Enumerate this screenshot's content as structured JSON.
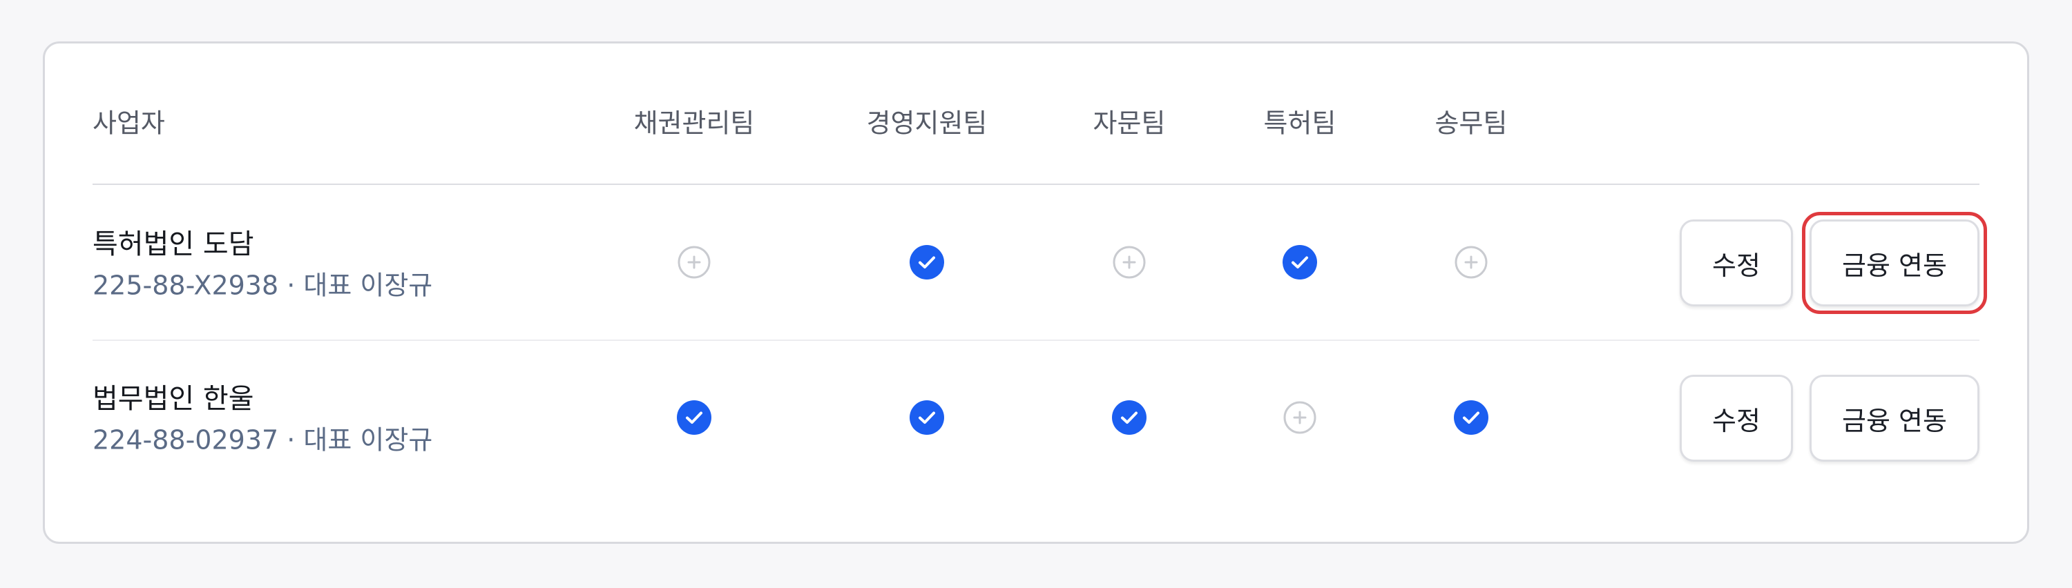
{
  "table": {
    "headers": {
      "business": "사업자",
      "teams": [
        "채권관리팀",
        "경영지원팀",
        "자문팀",
        "특허팀",
        "송무팀"
      ]
    },
    "rows": [
      {
        "name": "특허법인 도담",
        "sub": "225-88-X2938 · 대표 이장규",
        "teams": [
          false,
          true,
          false,
          true,
          false
        ],
        "edit_label": "수정",
        "link_label": "금융 연동",
        "link_highlighted": true
      },
      {
        "name": "법무법인 한울",
        "sub": "224-88-02937 · 대표 이장규",
        "teams": [
          true,
          true,
          true,
          false,
          true
        ],
        "edit_label": "수정",
        "link_label": "금융 연동",
        "link_highlighted": false
      }
    ]
  },
  "colors": {
    "checked": "#1b5ef0",
    "unchecked_ring": "#c9cbd0",
    "highlight": "#df3a3e"
  },
  "icons": {
    "checked": "check-circle-icon",
    "unchecked": "add-circle-icon"
  }
}
